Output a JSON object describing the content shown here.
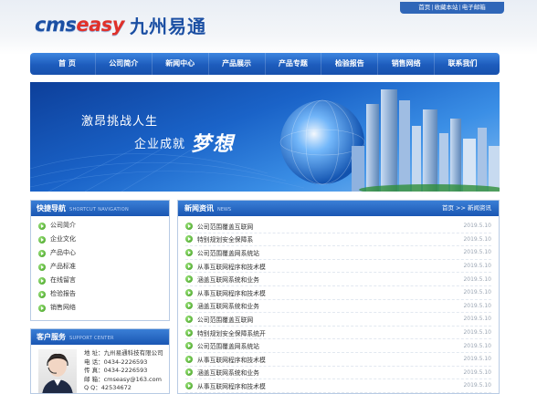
{
  "toplinks": {
    "home": "首页",
    "favorite": "收藏本站",
    "email": "电子邮箱"
  },
  "logo": {
    "en_prefix": "cms",
    "en_highlight": "easy",
    "cn": "九州易通"
  },
  "nav": [
    "首 页",
    "公司简介",
    "新闻中心",
    "产品展示",
    "产品专题",
    "检验报告",
    "销售网络",
    "联系我们"
  ],
  "banner": {
    "slogan1": "激昂挑战人生",
    "slogan2": "企业成就",
    "slogan3": "梦想"
  },
  "sidebar": {
    "title": "快捷导航",
    "title_en": "SHORTCUT NAVIGATION",
    "items": [
      "公司简介",
      "企业文化",
      "产品中心",
      "产品标准",
      "在线留言",
      "检验报告",
      "销售网络"
    ]
  },
  "support": {
    "title": "客户服务",
    "title_en": "SUPPORT CENTER",
    "lines": [
      "地 址：九州易通科技有限公司",
      "电 话：0434-2226593",
      "传 真：0434-2226593",
      "邮 箱：cmseasy@163.com",
      "Q Q：42534672"
    ]
  },
  "news": {
    "title": "新闻资讯",
    "title_en": "NEWS",
    "crumb": "首页 >> 新闻资讯",
    "items": [
      {
        "title": "公司范围覆盖互联网",
        "date": "2019.5.10"
      },
      {
        "title": "特别规划安全保障系",
        "date": "2019.5.10"
      },
      {
        "title": "公司范围覆盖网系统站",
        "date": "2019.5.10"
      },
      {
        "title": "从事互联网程序和技术模",
        "date": "2019.5.10"
      },
      {
        "title": "涵盖互联网系统和业务",
        "date": "2019.5.10"
      },
      {
        "title": "从事互联网程序和技术模",
        "date": "2019.5.10"
      },
      {
        "title": "涵盖互联网系统和业务",
        "date": "2019.5.10"
      },
      {
        "title": "公司范围覆盖互联网",
        "date": "2019.5.10"
      },
      {
        "title": "特别规划安全保障系统开",
        "date": "2019.5.10"
      },
      {
        "title": "公司范围覆盖网系统站",
        "date": "2019.5.10"
      },
      {
        "title": "从事互联网程序和技术模",
        "date": "2019.5.10"
      },
      {
        "title": "涵盖互联网系统和业务",
        "date": "2019.5.10"
      },
      {
        "title": "从事互联网程序和技术模",
        "date": "2019.5.10"
      }
    ]
  }
}
